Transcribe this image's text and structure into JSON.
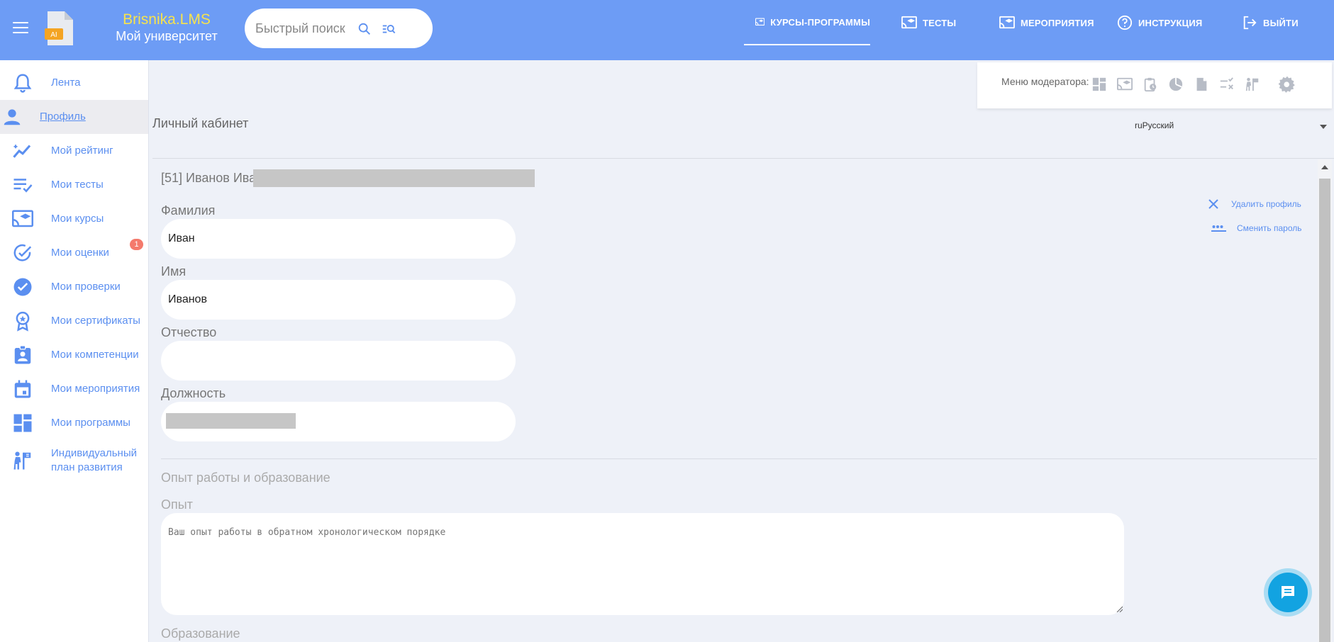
{
  "header": {
    "brand_name": "Brisnika.LMS",
    "brand_subtitle": "Мой университет",
    "logo_badge": "AI",
    "search_placeholder": "Быстрый поиск",
    "nav": [
      {
        "label": "КУРСЫ-ПРОГРАММЫ",
        "icon": "cast-education-icon",
        "active": true
      },
      {
        "label": "ТЕСТЫ",
        "icon": "cast-education-icon",
        "active": false
      },
      {
        "label": "МЕРОПРИЯТИЯ",
        "icon": "cast-education-icon",
        "active": false
      },
      {
        "label": "ИНСТРУКЦИЯ",
        "icon": "help-circle-icon",
        "active": false
      },
      {
        "label": "ВЫЙТИ",
        "icon": "logout-icon",
        "active": false
      }
    ],
    "colors": {
      "background": "#6d9cf5",
      "brand_accent": "#f7e34c"
    }
  },
  "sidebar": {
    "items": [
      {
        "label": "Лента",
        "icon": "bell-icon"
      },
      {
        "label": "Профиль",
        "icon": "person-icon",
        "active": true
      },
      {
        "label": "Мой рейтинг",
        "icon": "trending-up-icon"
      },
      {
        "label": "Мои тесты",
        "icon": "checklist-icon"
      },
      {
        "label": "Мои курсы",
        "icon": "cast-education-icon"
      },
      {
        "label": "Мои оценки",
        "icon": "check-circle-icon",
        "badge": "1"
      },
      {
        "label": "Мои проверки",
        "icon": "grading-icon"
      },
      {
        "label": "Мои сертификаты",
        "icon": "award-icon"
      },
      {
        "label": "Мои компетенции",
        "icon": "badge-id-icon"
      },
      {
        "label": "Мои мероприятия",
        "icon": "calendar-icon"
      },
      {
        "label": "Мои программы",
        "icon": "dashboard-icon"
      },
      {
        "label": "Индивидуальный план развития",
        "icon": "goal-person-icon"
      }
    ],
    "colors": {
      "link": "#5b8ff0",
      "badge": "#f47a6c"
    }
  },
  "moderator": {
    "label": "Меню модератора:",
    "icons": [
      "dashboard-icon",
      "cast-education-icon",
      "clipboard-clock-icon",
      "pie-chart-icon",
      "file-icon",
      "checklist-cross-icon",
      "goal-person-icon",
      "settings-icon"
    ]
  },
  "page": {
    "title": "Личный кабинет",
    "language": "ruРусский"
  },
  "profile": {
    "heading": "[51] Иванов Иван",
    "fields": [
      {
        "label": "Фамилия",
        "value": "Иван"
      },
      {
        "label": "Имя",
        "value": "Иванов"
      },
      {
        "label": "Отчество",
        "value": ""
      },
      {
        "label": "Должность",
        "value": ""
      }
    ],
    "actions": {
      "delete": "Удалить профиль",
      "change_password": "Сменить пароль"
    }
  },
  "experience": {
    "section_title": "Опыт работы и образование",
    "experience_label": "Опыт",
    "experience_placeholder": "Ваш опыт работы в обратном хронологическом порядке",
    "education_label": "Образование"
  }
}
